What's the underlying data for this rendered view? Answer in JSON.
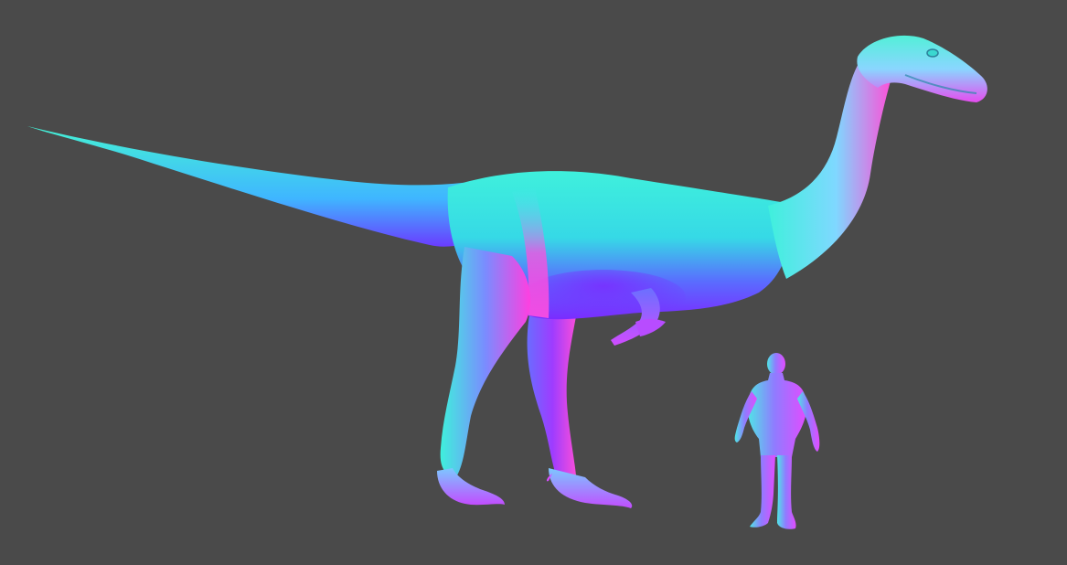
{
  "viewport": {
    "background": "#4a4a4a"
  },
  "palette": {
    "normal_cyan": "#3ff0dc",
    "normal_teal": "#2fe6c0",
    "normal_blue": "#4f6dff",
    "normal_violet": "#7a2cff",
    "normal_magenta": "#e033ff",
    "normal_pink": "#ff4fd8"
  },
  "objects": [
    {
      "name": "dinosaur-model",
      "shading": "normal-map"
    },
    {
      "name": "human-model",
      "shading": "normal-map"
    }
  ]
}
